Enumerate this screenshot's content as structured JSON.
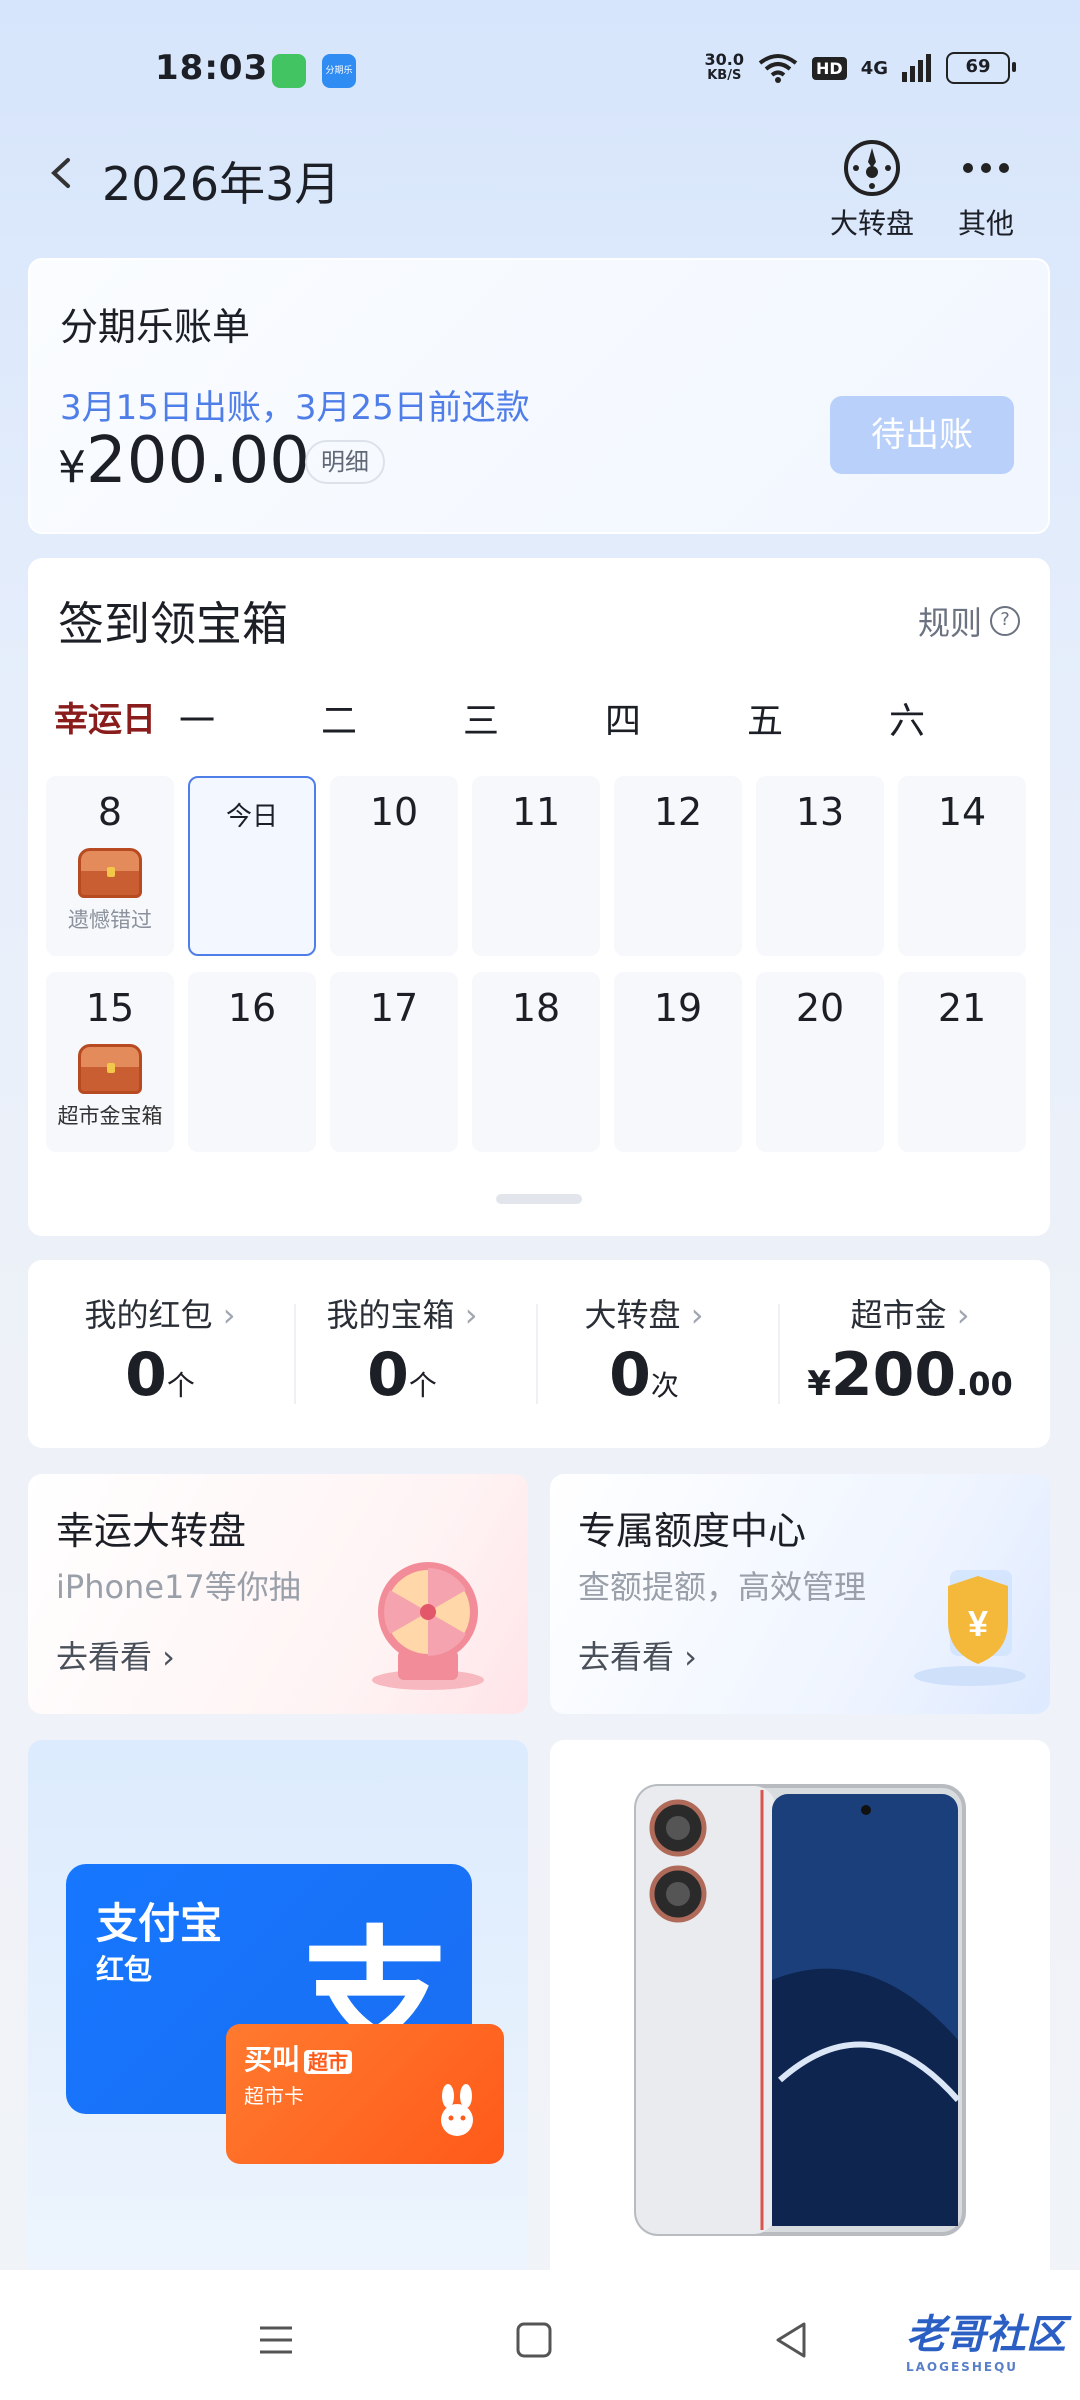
{
  "status_bar": {
    "time": "18:03",
    "net_speed": "30.0",
    "net_unit": "KB/S",
    "hd": "HD",
    "network": "4G",
    "battery": "69",
    "app_small_label": "分期乐"
  },
  "header": {
    "title": "2026年3月",
    "buttons": [
      {
        "label": "大转盘",
        "icon": "wheel-icon"
      },
      {
        "label": "其他",
        "icon": "more-icon"
      }
    ]
  },
  "bill": {
    "title": "分期乐账单",
    "subtitle": "3月15日出账，3月25日前还款",
    "currency": "¥",
    "amount": "200.00",
    "detail_label": "明细",
    "action_label": "待出账"
  },
  "checkin": {
    "title": "签到领宝箱",
    "rules_label": "规则",
    "weekdays": [
      "幸运日",
      "一",
      "二",
      "三",
      "四",
      "五",
      "六"
    ],
    "week1": [
      {
        "num": "8",
        "caption": "遗憾错过",
        "chest": true
      },
      {
        "num": "今日",
        "caption": "",
        "chest": false,
        "today": true
      },
      {
        "num": "10"
      },
      {
        "num": "11"
      },
      {
        "num": "12"
      },
      {
        "num": "13"
      },
      {
        "num": "14"
      }
    ],
    "week2": [
      {
        "num": "15",
        "caption": "超市金宝箱",
        "chest": true
      },
      {
        "num": "16"
      },
      {
        "num": "17"
      },
      {
        "num": "18"
      },
      {
        "num": "19"
      },
      {
        "num": "20"
      },
      {
        "num": "21"
      }
    ]
  },
  "stats": [
    {
      "label": "我的红包",
      "value": "0",
      "unit": "个"
    },
    {
      "label": "我的宝箱",
      "value": "0",
      "unit": "个"
    },
    {
      "label": "大转盘",
      "value": "0",
      "unit": "次"
    },
    {
      "label": "超市金",
      "currency": "¥",
      "value": "200",
      "decimal": ".00"
    }
  ],
  "promos": [
    {
      "title": "幸运大转盘",
      "subtitle": "iPhone17等你抽",
      "cta": "去看看 ›"
    },
    {
      "title": "专属额度中心",
      "subtitle": "查额提额，高效管理",
      "cta": "去看看 ›"
    }
  ],
  "products": {
    "alipay": {
      "title": "支付宝",
      "subtitle": "红包",
      "mark": "支"
    },
    "market_card": {
      "brand": "买叫",
      "badge": "超市",
      "label": "超市卡"
    }
  },
  "watermark": {
    "text": "老哥社区",
    "sub": "LAOGESHEQU"
  },
  "colors": {
    "accent": "#4f7ee8",
    "pay_button": "#b9d0fa",
    "alipay_blue": "#1677ff",
    "market_orange": "#ff5a1a",
    "lucky_red": "#8a1c1c"
  }
}
